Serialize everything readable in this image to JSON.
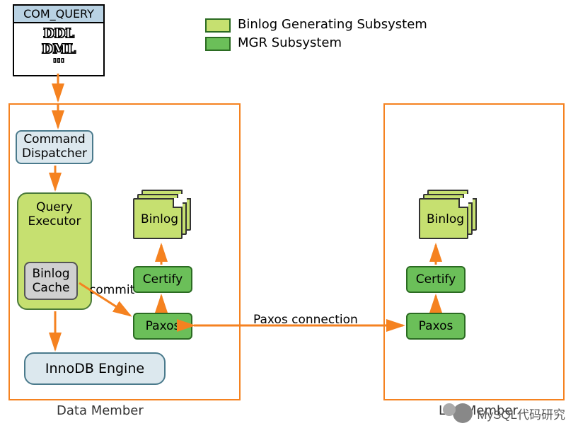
{
  "legend": {
    "binlog_subsystem": "Binlog Generating Subsystem",
    "mgr_subsystem": "MGR Subsystem"
  },
  "com_query": {
    "header": "COM_QUERY",
    "line1": "DDL",
    "line2": "DML",
    "line3": "'''"
  },
  "nodes": {
    "command_dispatcher_l1": "Command",
    "command_dispatcher_l2": "Dispatcher",
    "query_executor_l1": "Query",
    "query_executor_l2": "Executor",
    "binlog_cache_l1": "Binlog",
    "binlog_cache_l2": "Cache",
    "innodb_engine": "InnoDB Engine",
    "certify": "Certify",
    "paxos": "Paxos",
    "binlog": "Binlog"
  },
  "containers": {
    "data_member": "Data Member",
    "log_member": "Log Member"
  },
  "edges": {
    "commit": "commit",
    "paxos_connection": "Paxos connection"
  },
  "watermark": "MySQL代码研究"
}
